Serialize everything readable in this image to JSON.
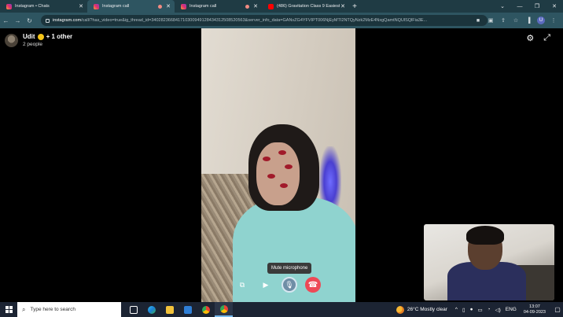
{
  "browser": {
    "tabs": [
      {
        "label": "Instagram • Chats",
        "active": false,
        "audio": false
      },
      {
        "label": "Instagram call",
        "active": true,
        "audio": true
      },
      {
        "label": "Instagram call",
        "active": false,
        "audio": true
      },
      {
        "label": "(486) Gravitation Class 9 Easiest",
        "active": false,
        "audio": true
      }
    ],
    "url_host": "instagram.com",
    "url_rest": "/call/?has_video=true&ig_thread_id=340282366841710300949128434312508520563&server_info_data=GANvZG4YFVIPT006NjEyMTI2NTQyNzk2MzE4NxgQamtNQUlSQlFia3E..."
  },
  "call": {
    "name": "Udit",
    "others": "+ 1 other",
    "people_count": "2 people",
    "tooltip": "Mute microphone"
  },
  "taskbar": {
    "search_placeholder": "Type here to search",
    "weather": "26°C  Mostly clear",
    "language": "ENG",
    "time": "13:07",
    "date": "04-09-2023"
  },
  "colors": {
    "end_call": "#ed4956",
    "browser_frame": "#1f3b44"
  }
}
